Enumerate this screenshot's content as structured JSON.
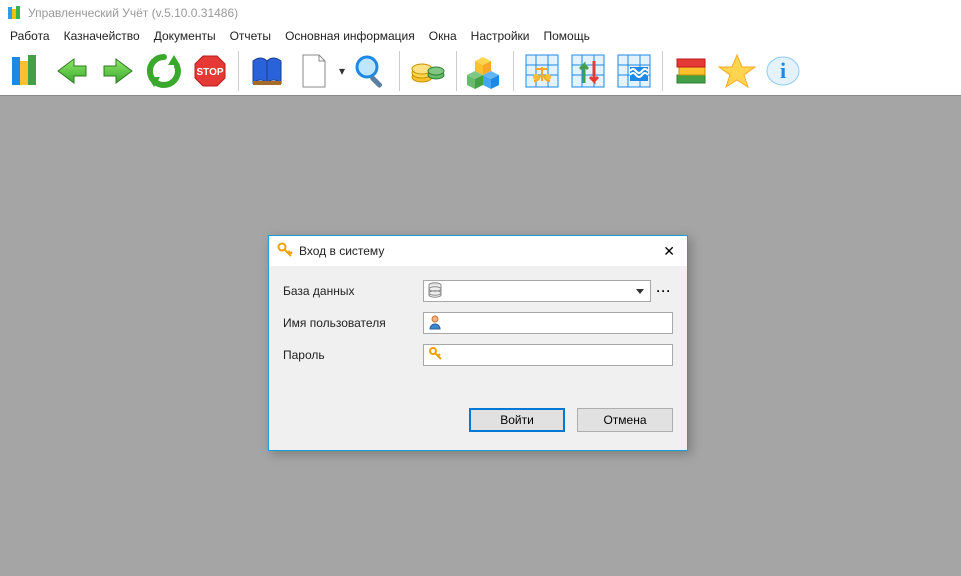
{
  "window": {
    "title": "Управленческий Учёт (v.5.10.0.31486)"
  },
  "menu": {
    "items": [
      "Работа",
      "Казначейство",
      "Документы",
      "Отчеты",
      "Основная информация",
      "Окна",
      "Настройки",
      "Помощь"
    ]
  },
  "toolbar": {
    "icons": [
      "app",
      "back",
      "forward",
      "refresh",
      "stop",
      "sep",
      "book",
      "new-doc",
      "new-doc-drop",
      "search",
      "sep",
      "money",
      "sep",
      "cubes",
      "sep",
      "balance-grid",
      "arrows-grid",
      "waves-grid",
      "sep",
      "books-stack",
      "star",
      "info"
    ]
  },
  "login": {
    "title": "Вход в систему",
    "db_label": "База данных",
    "db_value": "",
    "user_label": "Имя пользователя",
    "user_value": "",
    "pass_label": "Пароль",
    "pass_value": "",
    "login_btn": "Войти",
    "cancel_btn": "Отмена"
  }
}
